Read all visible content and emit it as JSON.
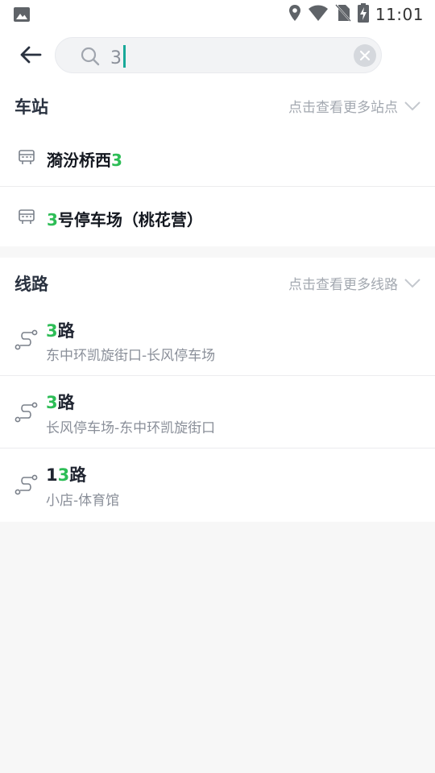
{
  "status_bar": {
    "time": "11:01",
    "icons": [
      "image-icon",
      "location-icon",
      "wifi-icon",
      "no-sim-icon",
      "battery-charging-icon"
    ]
  },
  "search": {
    "back_icon": "arrow-left-icon",
    "search_icon": "search-icon",
    "value": "3",
    "clear_icon": "clear-icon"
  },
  "stations": {
    "title": "车站",
    "more": "点击查看更多站点",
    "items": [
      {
        "name_before": "漪汾桥西",
        "name_match": "3",
        "name_after": ""
      },
      {
        "name_before": "",
        "name_match": "3",
        "name_after": "号停车场（桃花营）"
      }
    ]
  },
  "lines": {
    "title": "线路",
    "more": "点击查看更多线路",
    "items": [
      {
        "name_before": "",
        "name_match": "3",
        "name_after": "路",
        "desc": "东中环凯旋街口-长风停车场"
      },
      {
        "name_before": "",
        "name_match": "3",
        "name_after": "路",
        "desc": "长风停车场-东中环凯旋街口"
      },
      {
        "name_before": "1",
        "name_match": "3",
        "name_after": "路",
        "desc": "小店-体育馆"
      }
    ]
  },
  "colors": {
    "highlight": "#2dbd56",
    "cursor": "#18a999",
    "background": "#f7f7f7"
  }
}
